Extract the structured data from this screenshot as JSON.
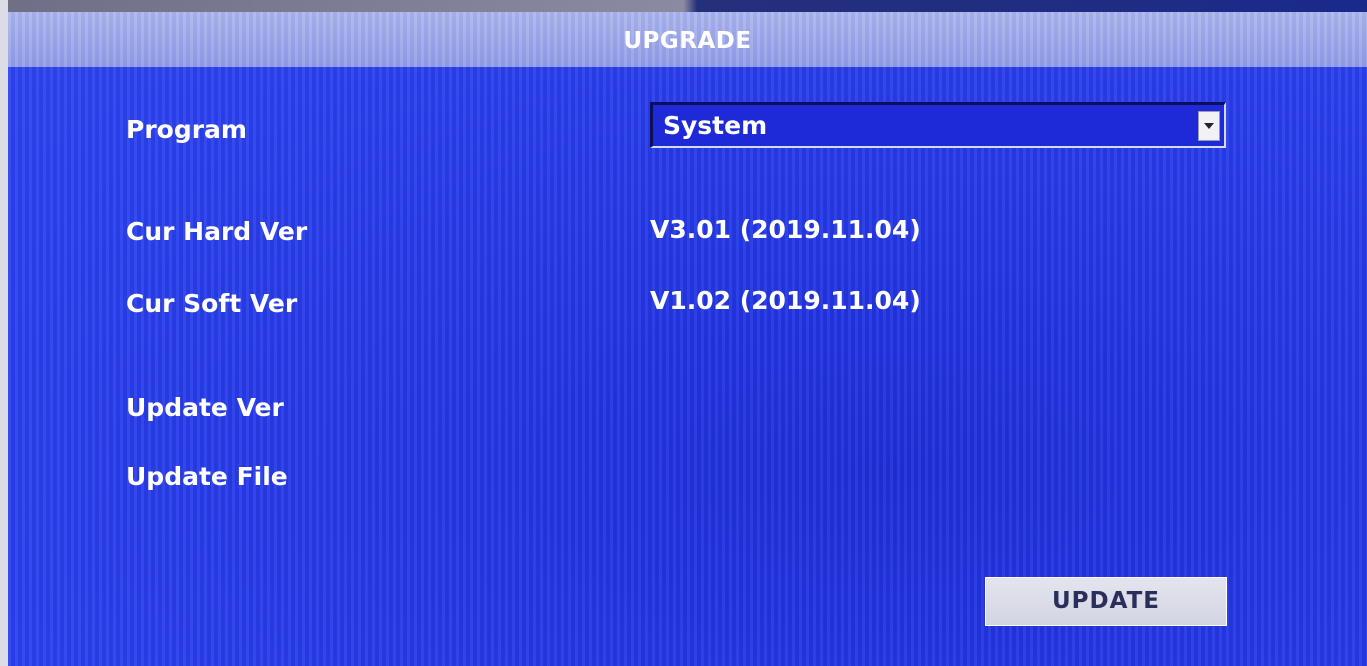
{
  "dialog": {
    "title": "UPGRADE"
  },
  "fields": {
    "program": {
      "label": "Program",
      "selected": "System"
    },
    "cur_hard_ver": {
      "label": "Cur Hard Ver",
      "value": "V3.01 (2019.11.04)"
    },
    "cur_soft_ver": {
      "label": "Cur Soft Ver",
      "value": "V1.02 (2019.11.04)"
    },
    "update_ver": {
      "label": "Update Ver",
      "value": ""
    },
    "update_file": {
      "label": "Update File",
      "value": ""
    }
  },
  "buttons": {
    "update_label": "UPDATE"
  },
  "icons": {
    "dropdown": "chevron-down-icon"
  },
  "colors": {
    "panel_blue": "#2a40ee",
    "titlebar": "#a9b4ec",
    "text": "#ffffff",
    "button_bg": "#e4e5ee",
    "button_text": "#2a2e5a"
  }
}
